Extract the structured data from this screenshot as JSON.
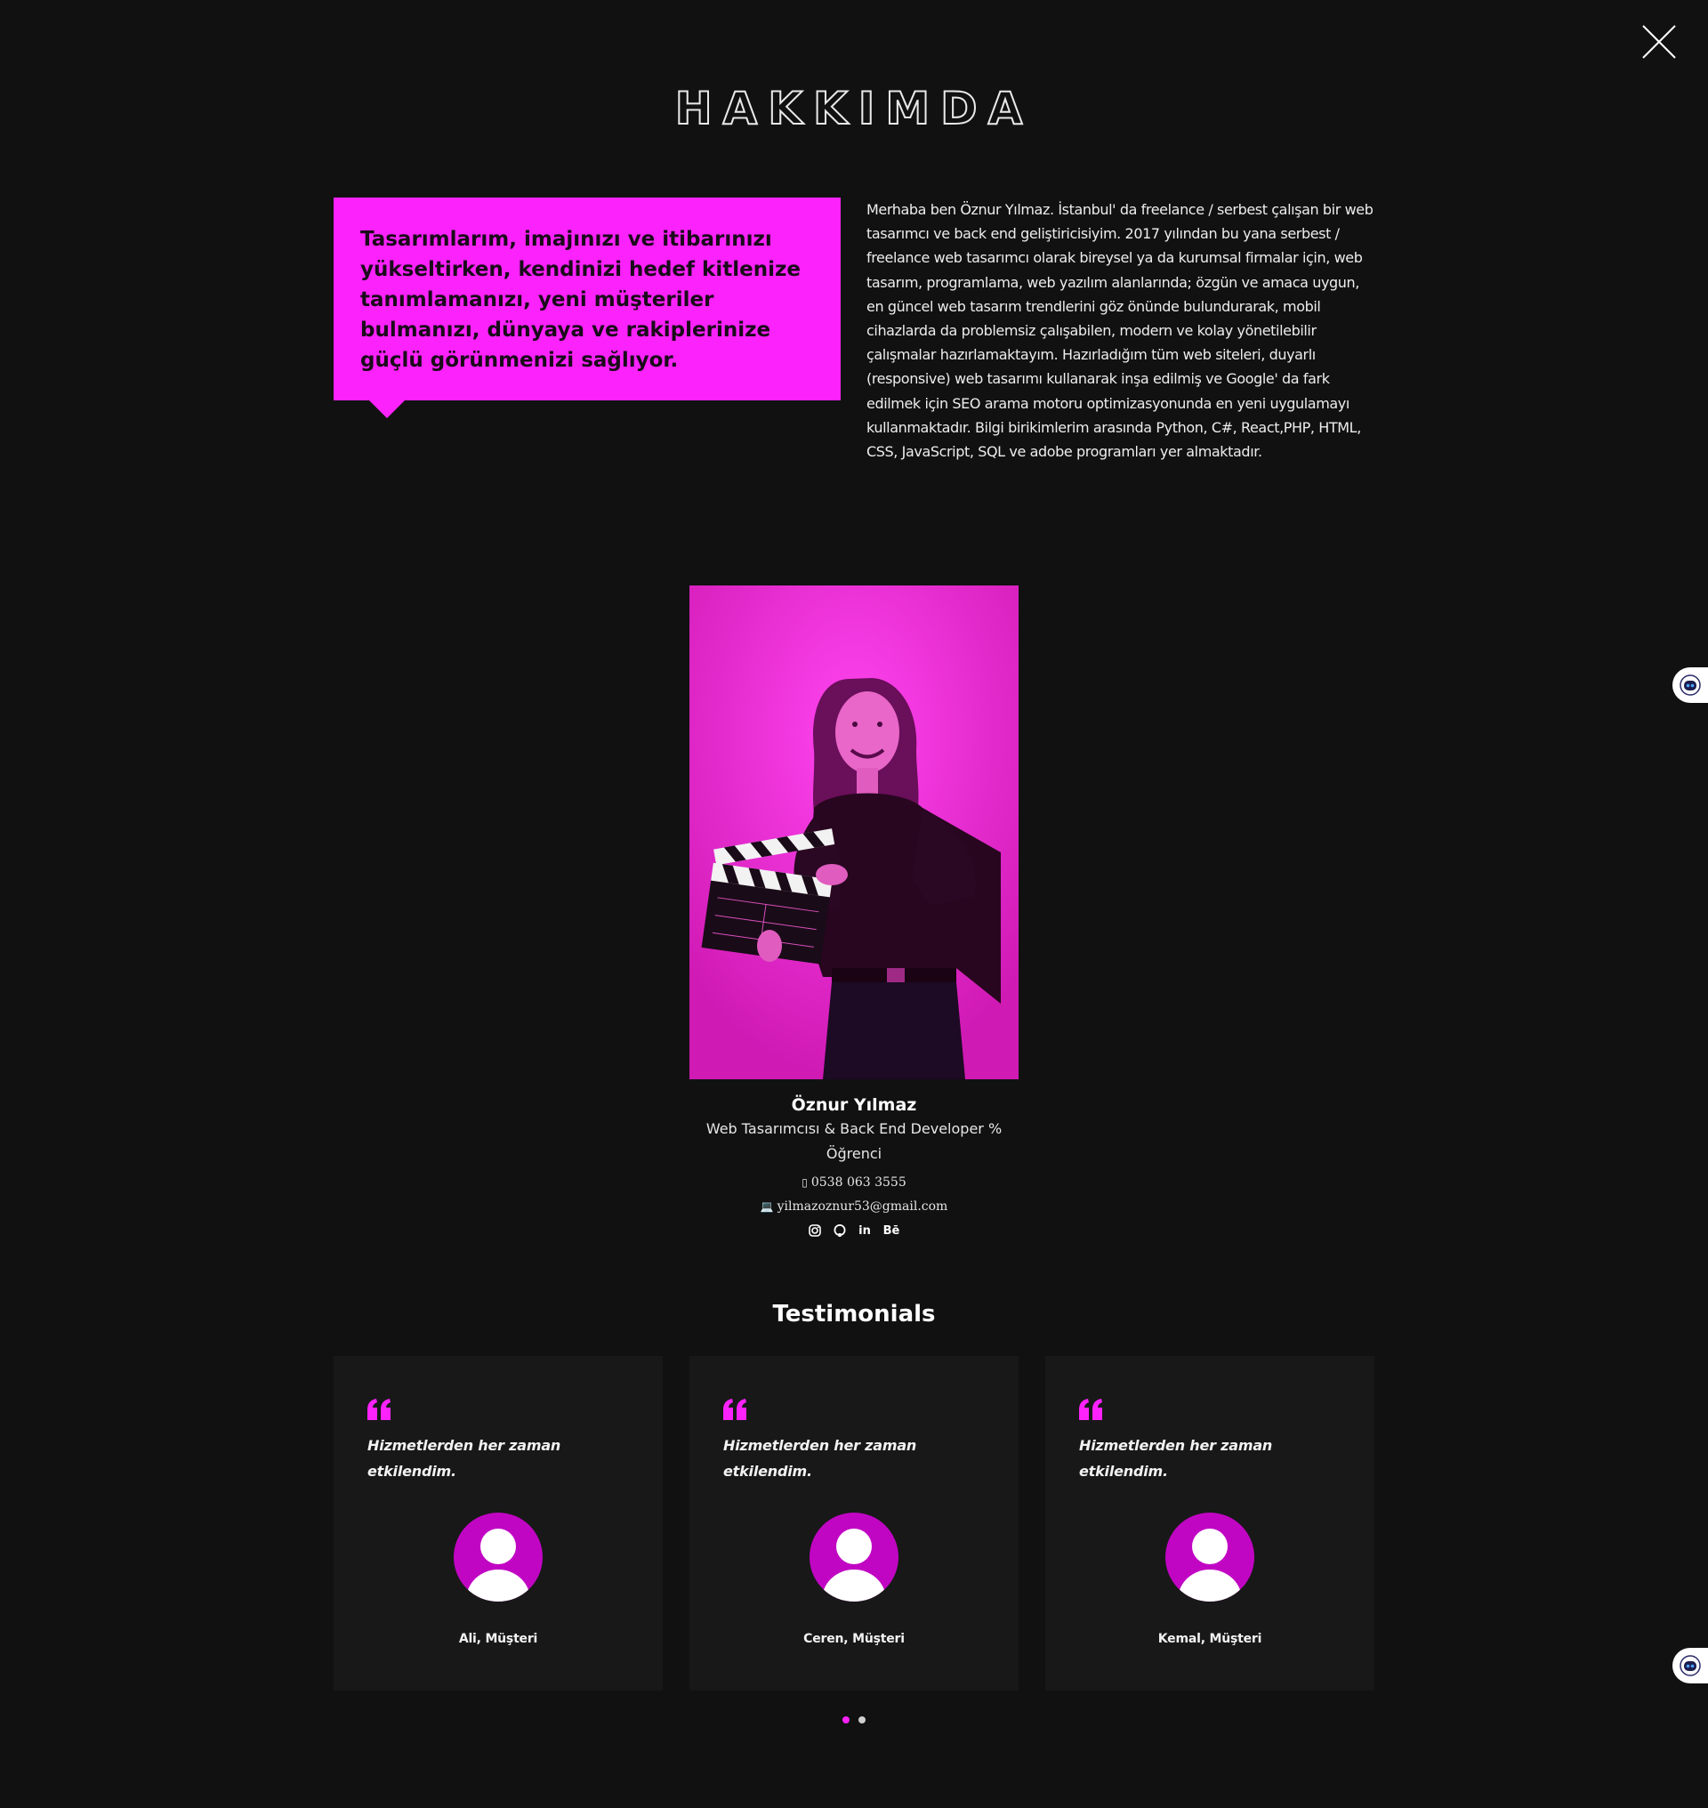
{
  "page": {
    "title": "HAKKIMDA",
    "close_icon": "close-icon"
  },
  "about": {
    "quote": "Tasarımlarım, imajınızı ve itibarınızı yükseltirken, kendinizi hedef kitlenize tanımlamanızı, yeni müşteriler bulmanızı, dünyaya ve rakiplerinize güçlü görünmenizi sağlıyor.",
    "bio": "Merhaba ben Öznur Yılmaz. İstanbul' da freelance / serbest çalışan bir web tasarımcı ve back end geliştiricisiyim. 2017 yılından bu yana serbest / freelance web tasarımcı olarak bireysel ya da kurumsal firmalar için, web tasarım, programlama, web yazılım alanlarında; özgün ve amaca uygun, en güncel web tasarım trendlerini göz önünde bulundurarak, mobil cihazlarda da problemsiz çalışabilen, modern ve kolay yönetilebilir çalışmalar hazırlamaktayım. Hazırladığım tüm web siteleri, duyarlı (responsive) web tasarımı kullanarak inşa edilmiş ve Google' da fark edilmek için SEO arama motoru optimizasyonunda en yeni uygulamayı kullanmaktadır. Bilgi birikimlerim arasında Python, C#, React,PHP, HTML, CSS, JavaScript, SQL ve adobe programları yer almaktadır."
  },
  "profile": {
    "name": "Öznur Yılmaz",
    "role": "Web Tasarımcısı & Back End Developer % Öğrenci",
    "phone_icon": "▯",
    "phone": "0538 063 3555",
    "email_icon": "💻",
    "email": "yilmazoznur53@gmail.com",
    "socials": [
      {
        "name": "instagram-icon"
      },
      {
        "name": "github-icon"
      },
      {
        "name": "linkedin-icon",
        "label": "in"
      },
      {
        "name": "behance-icon",
        "label": "Bē"
      }
    ]
  },
  "testimonials": {
    "title": "Testimonials",
    "items": [
      {
        "text": "Hizmetlerden her zaman etkilendim.",
        "author": "Ali, Müşteri"
      },
      {
        "text": "Hizmetlerden her zaman etkilendim.",
        "author": "Ceren, Müşteri"
      },
      {
        "text": "Hizmetlerden her zaman etkilendim.",
        "author": "Kemal, Müşteri"
      }
    ],
    "pages": 2,
    "active_page": 1
  },
  "colors": {
    "background": "#111111",
    "accent": "#fb22fb",
    "card": "#181818",
    "avatar": "#c106c3"
  }
}
